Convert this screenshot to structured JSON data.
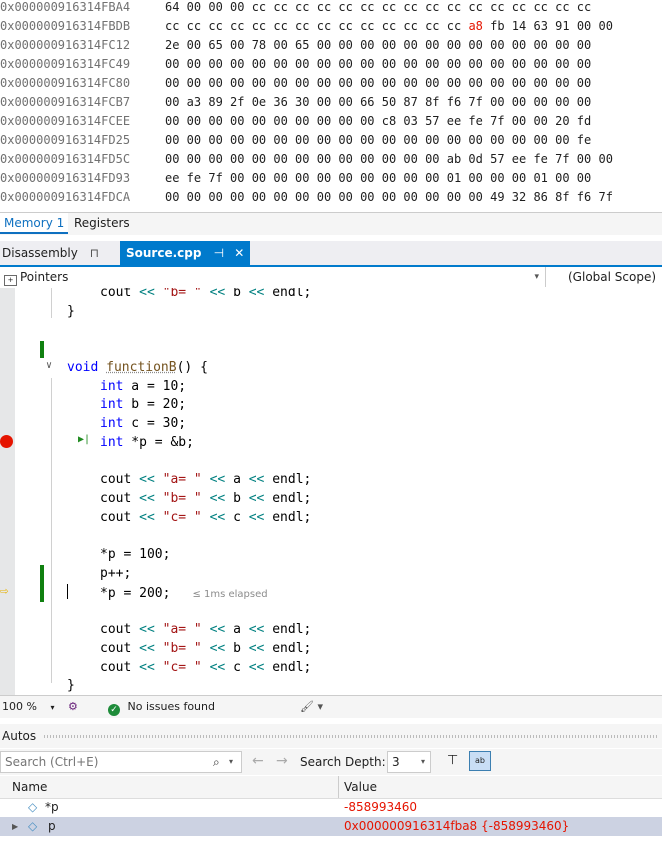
{
  "memory": {
    "rows": [
      {
        "addr": "0x000000916314FBA4",
        "bytes": "64 00 00 00 cc cc cc cc cc cc cc cc cc cc cc cc cc cc cc cc",
        "chg": ""
      },
      {
        "addr": "0x000000916314FBDB",
        "bytes": "cc cc cc cc cc cc cc cc cc cc cc cc cc cc",
        "chg": "a8",
        "rest": " fb 14 63 91 00 00"
      },
      {
        "addr": "0x000000916314FC12",
        "bytes": "2e 00 65 00 78 00 65 00 00 00 00 00 00 00 00 00 00 00 00 00",
        "chg": ""
      },
      {
        "addr": "0x000000916314FC49",
        "bytes": "00 00 00 00 00 00 00 00 00 00 00 00 00 00 00 00 00 00 00 00",
        "chg": ""
      },
      {
        "addr": "0x000000916314FC80",
        "bytes": "00 00 00 00 00 00 00 00 00 00 00 00 00 00 00 00 00 00 00 00",
        "chg": ""
      },
      {
        "addr": "0x000000916314FCB7",
        "bytes": "00 a3 89 2f 0e 36 30 00 00 66 50 87 8f f6 7f 00 00 00 00 00",
        "chg": ""
      },
      {
        "addr": "0x000000916314FCEE",
        "bytes": "00 00 00 00 00 00 00 00 00 00 c8 03 57 ee fe 7f 00 00 20 fd",
        "chg": ""
      },
      {
        "addr": "0x000000916314FD25",
        "bytes": "00 00 00 00 00 00 00 00 00 00 00 00 00 00 00 00 00 00 00 fe",
        "chg": ""
      },
      {
        "addr": "0x000000916314FD5C",
        "bytes": "00 00 00 00 00 00 00 00 00 00 00 00 00 ab 0d 57 ee fe 7f 00 00",
        "chg": ""
      },
      {
        "addr": "0x000000916314FD93",
        "bytes": "ee fe 7f 00 00 00 00 00 00 00 00 00 00 01 00 00 00 01 00 00",
        "chg": ""
      },
      {
        "addr": "0x000000916314FDCA",
        "bytes": "00 00 00 00 00 00 00 00 00 00 00 00 00 00 00 49 32 86 8f f6 7f",
        "chg": ""
      }
    ],
    "tabs": [
      "Memory 1",
      "Registers"
    ]
  },
  "doc_tabs": {
    "disassembly": "Disassembly",
    "disassembly_pin": "⊓",
    "source": "Source.cpp",
    "source_pin": "⊣",
    "close": "✕"
  },
  "navbar": {
    "project": "Pointers",
    "scope": "(Global Scope)"
  },
  "code": {
    "l0": {
      "a": "cout",
      "b": " << ",
      "c": "\"b= \"",
      "d": " << ",
      "e": "b",
      "f": " << ",
      "g": "endl;"
    },
    "l1": "}",
    "fn_kw": "void",
    "fn_name": "functionB",
    "fn_rest": "() {",
    "int": "int",
    "decl_a": " a = 10;",
    "decl_b": " b = 20;",
    "decl_c": " c = 30;",
    "decl_p": " *p = &b;",
    "cout": "cout",
    "shl": "<<",
    "endl": "endl;",
    "s_a": "\"a= \"",
    "s_b": "\"b= \"",
    "s_c": "\"c= \"",
    "v_a": "a",
    "v_b": "b",
    "v_c": "c",
    "assign1": "*p = 100;",
    "inc": "p++;",
    "assign2": "*p = 200;",
    "elapsed": "≤ 1ms elapsed",
    "close_brace": "}"
  },
  "status": {
    "zoom": "100 %",
    "issues": "No issues found"
  },
  "autos": {
    "title": "Autos",
    "search_placeholder": "Search (Ctrl+E)",
    "depth_label": "Search Depth:",
    "depth_value": "3",
    "col_name": "Name",
    "col_value": "Value",
    "rows": [
      {
        "name": "*p",
        "value": "-858993460"
      },
      {
        "name": "p",
        "value": "0x000000916314fba8 {-858993460}"
      }
    ]
  }
}
